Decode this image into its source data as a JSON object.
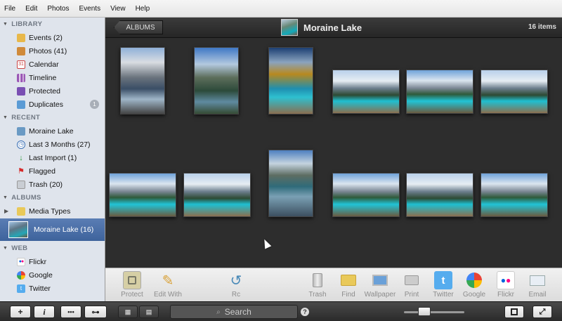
{
  "menu": [
    "File",
    "Edit",
    "Photos",
    "Events",
    "View",
    "Help"
  ],
  "sidebar": {
    "library_title": "LIBRARY",
    "library": [
      {
        "label": "Events (2)",
        "icon": "events-icon"
      },
      {
        "label": "Photos (41)",
        "icon": "photos-icon"
      },
      {
        "label": "Calendar",
        "icon": "calendar-icon"
      },
      {
        "label": "Timeline",
        "icon": "timeline-icon"
      },
      {
        "label": "Protected",
        "icon": "protected-icon"
      },
      {
        "label": "Duplicates",
        "icon": "duplicates-icon",
        "badge": "1"
      }
    ],
    "recent_title": "RECENT",
    "recent": [
      {
        "label": "Moraine Lake",
        "icon": "album-icon"
      },
      {
        "label": "Last 3 Months (27)",
        "icon": "clock-icon"
      },
      {
        "label": "Last Import (1)",
        "icon": "import-icon"
      },
      {
        "label": "Flagged",
        "icon": "flag-icon"
      },
      {
        "label": "Trash (20)",
        "icon": "trash-icon"
      }
    ],
    "albums_title": "ALBUMS",
    "albums": [
      {
        "label": "Media Types",
        "icon": "folder-icon"
      },
      {
        "label": "Moraine Lake (16)",
        "icon": "album-thumb"
      }
    ],
    "web_title": "WEB",
    "web": [
      {
        "label": "Flickr",
        "icon": "flickr-icon"
      },
      {
        "label": "Google",
        "icon": "google-icon"
      },
      {
        "label": "Twitter",
        "icon": "twitter-icon"
      }
    ]
  },
  "topbar": {
    "back_label": "ALBUMS",
    "title": "Moraine Lake",
    "count": "16 items"
  },
  "toolbar": {
    "left": [
      {
        "label": "Protect",
        "icon": "protect-icon"
      },
      {
        "label": "Edit With",
        "icon": "pencil-icon"
      },
      {
        "label": "Rc",
        "icon": "rotate-icon"
      }
    ],
    "right": [
      {
        "label": "Trash",
        "icon": "trash-icon"
      },
      {
        "label": "Find",
        "icon": "folder-icon"
      },
      {
        "label": "Wallpaper",
        "icon": "monitor-icon"
      },
      {
        "label": "Print",
        "icon": "printer-icon"
      },
      {
        "label": "Twitter",
        "icon": "twitter-icon"
      },
      {
        "label": "Google",
        "icon": "google-icon"
      },
      {
        "label": "Flickr",
        "icon": "flickr-icon"
      },
      {
        "label": "Email",
        "icon": "envelope-icon"
      }
    ]
  },
  "bottombar": {
    "add": "+",
    "info": "i",
    "search_placeholder": "Search",
    "help": "?"
  },
  "colors": {
    "accent": "#4a6fa8",
    "flickr_pink": "#ff0084",
    "flickr_blue": "#0063dc",
    "twitter": "#55acee"
  }
}
